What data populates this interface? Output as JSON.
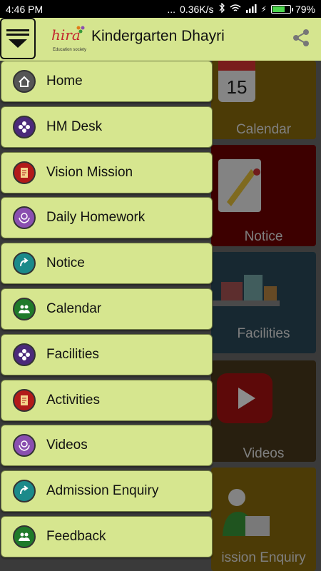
{
  "status": {
    "time": "4:46 PM",
    "dots": "...",
    "speed": "0.36K/s",
    "battery": "79%",
    "battery_level": 79
  },
  "appbar": {
    "logo_text": "hira",
    "logo_sub": "Education society",
    "title": "Kindergarten Dhayri"
  },
  "tiles": [
    {
      "label": "Calendar",
      "color": "#8a6c0c"
    },
    {
      "label": "Notice",
      "color": "#700000"
    },
    {
      "label": "Facilities",
      "color": "#2a4a5a"
    },
    {
      "label": "Videos",
      "color": "#4a3a1c"
    },
    {
      "label": "ission Enquiry",
      "color": "#8a6c0c"
    }
  ],
  "menu": [
    {
      "label": "Home",
      "icon": "house-icon",
      "color": "#555555"
    },
    {
      "label": "HM Desk",
      "icon": "flower-icon",
      "color": "#4b2a7a"
    },
    {
      "label": "Vision Mission",
      "icon": "document-icon",
      "color": "#b21a1a"
    },
    {
      "label": "Daily Homework",
      "icon": "hands-globe-icon",
      "color": "#8a4fb0"
    },
    {
      "label": "Notice",
      "icon": "arrow-icon",
      "color": "#1b8a8a"
    },
    {
      "label": "Calendar",
      "icon": "people-icon",
      "color": "#1f7a2a"
    },
    {
      "label": "Facilities",
      "icon": "flower-icon",
      "color": "#4b2a7a"
    },
    {
      "label": "Activities",
      "icon": "document-icon",
      "color": "#b21a1a"
    },
    {
      "label": "Videos",
      "icon": "hands-globe-icon",
      "color": "#8a4fb0"
    },
    {
      "label": "Admission Enquiry",
      "icon": "arrow-icon",
      "color": "#1b8a8a"
    },
    {
      "label": "Feedback",
      "icon": "people-icon",
      "color": "#1f7a2a"
    }
  ]
}
